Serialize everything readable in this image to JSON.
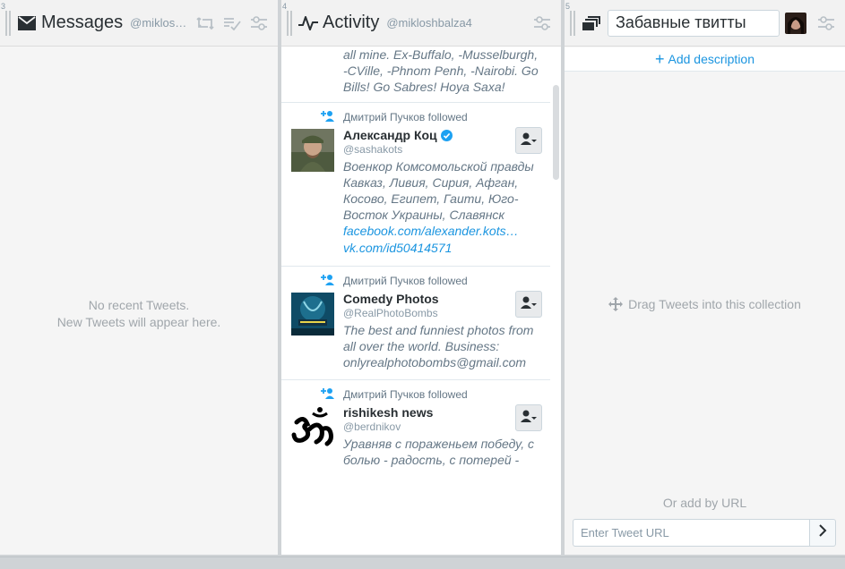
{
  "columns": {
    "messages": {
      "number": "3",
      "title": "Messages",
      "account": "@miklos…",
      "empty_line1": "No recent Tweets.",
      "empty_line2": "New Tweets will appear here."
    },
    "activity": {
      "number": "4",
      "title": "Activity",
      "account": "@mikloshbalza4",
      "top_fragment": "all mine. Ex-Buffalo, -Musselburgh, -CVille, -Phnom Penh, -Nairobi. Go Bills! Go Sabres! Hoya Saxa!",
      "items": [
        {
          "followed_text": "Дмитрий Пучков followed",
          "name": "Александр Коц",
          "handle": "@sashakots",
          "bio": "Военкор Комсомольской правды Кавказ, Ливия, Сирия, Афган, Косово, Египет, Гаити, Юго-Восток Украины, Славянск",
          "link1": "facebook.com/alexander.kots…",
          "link2": "vk.com/id50414571"
        },
        {
          "followed_text": "Дмитрий Пучков followed",
          "name": "Comedy Photos",
          "handle": "@RealPhotoBombs",
          "bio": "The best and funniest photos from all over the world. Business: onlyrealphotobombs@gmail.com"
        },
        {
          "followed_text": "Дмитрий Пучков followed",
          "name": "rishikesh news",
          "handle": "@berdnikov",
          "bio": "Уравняв с пораженьем победу, с болью - радость, с потерей -"
        }
      ]
    },
    "collection": {
      "number": "5",
      "title_value": "Забавные твитты",
      "add_description": "Add description",
      "drag_hint": "Drag Tweets into this collection",
      "or_add_by_url": "Or add by URL",
      "url_placeholder": "Enter Tweet URL"
    }
  },
  "colors": {
    "accent": "#1b95e0",
    "muted_text": "#8899a6",
    "background": "#f5f5f5"
  },
  "icons": {
    "messages": "envelope-icon",
    "activity": "pulse-icon",
    "collection": "collection-icon",
    "retweet": "retweet-icon",
    "mark_read": "checklist-icon",
    "settings": "sliders-icon",
    "follow": "follow-user-icon",
    "followed": "user-plus-icon",
    "verified": "verified-icon",
    "move": "move-icon",
    "submit": "chevron-right-icon"
  }
}
